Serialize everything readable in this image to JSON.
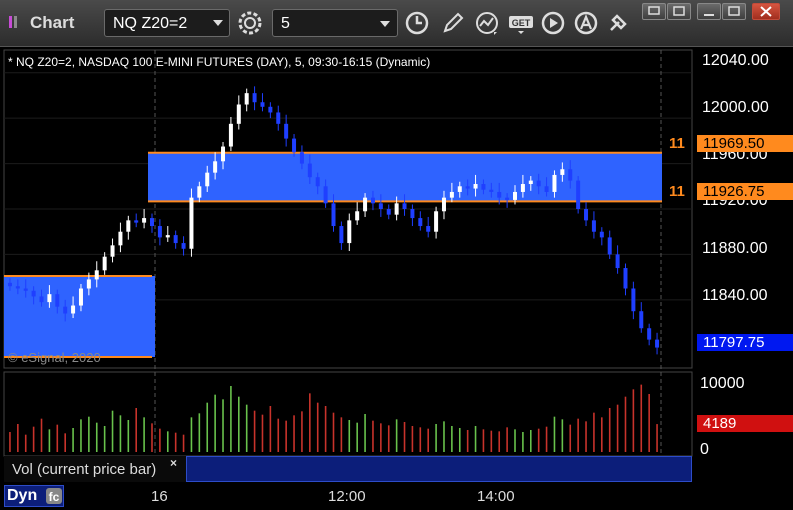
{
  "app": {
    "title": "Chart"
  },
  "toolbar": {
    "symbol": "NQ Z20=2",
    "interval": "5",
    "buttons": [
      "settings-gear-icon",
      "clock-icon",
      "pencil-icon",
      "line-study-icon",
      "get-data-icon",
      "play-icon",
      "alert-a-icon",
      "tools-icon"
    ]
  },
  "chart": {
    "info": "* NQ Z20=2, NASDAQ 100 E-MINI FUTURES (DAY), 5, 09:30-16:15 (Dynamic)",
    "copyright": "© eSignal, 2020",
    "price_labels": [
      "12040.00",
      "12000.00",
      "11960.00",
      "11920.00",
      "11880.00",
      "11840.00"
    ],
    "upper_line_label": "11969.50",
    "lower_line_label": "11926.75",
    "left_tag": "11",
    "last_price": "11797.75",
    "time_labels": [
      "16",
      "12:00",
      "14:00"
    ]
  },
  "volume": {
    "label": "Vol (current price bar)",
    "close_symbol": "×",
    "axis_labels": [
      "10000",
      "0"
    ],
    "current": "4189"
  },
  "footer": {
    "mode": "Dyn"
  },
  "colors": {
    "up": "#ffffff",
    "down": "#1f3fff",
    "zone": "#2f63ff",
    "line": "#ff8a1e",
    "vol_up": "#69c24c",
    "vol_down": "#c8332b"
  },
  "chart_data": {
    "type": "candlestick",
    "y_range": [
      11780,
      12060
    ],
    "volume_range": [
      0,
      12000
    ],
    "highlight_zones": [
      {
        "from": 11926.75,
        "to": 11969.5
      }
    ],
    "y_ticks": [
      12040,
      12000,
      11960,
      11920,
      11880,
      11840
    ],
    "closes": [
      11852,
      11850,
      11848,
      11843,
      11838,
      11845,
      11834,
      11828,
      11835,
      11850,
      11858,
      11866,
      11878,
      11888,
      11900,
      11910,
      11908,
      11912,
      11905,
      11895,
      11897,
      11890,
      11885,
      11930,
      11940,
      11952,
      11962,
      11975,
      11995,
      12012,
      12022,
      12014,
      12010,
      12005,
      11995,
      11982,
      11970,
      11960,
      11948,
      11940,
      11925,
      11905,
      11890,
      11910,
      11918,
      11930,
      11925,
      11920,
      11915,
      11925,
      11920,
      11912,
      11905,
      11900,
      11918,
      11930,
      11935,
      11940,
      11938,
      11942,
      11937,
      11935,
      11930,
      11928,
      11935,
      11942,
      11945,
      11940,
      11935,
      11950,
      11955,
      11945,
      11920,
      11910,
      11900,
      11895,
      11880,
      11868,
      11850,
      11830,
      11815,
      11805,
      11798
    ],
    "volumes": [
      3000,
      4200,
      2600,
      3800,
      5000,
      3400,
      4100,
      2800,
      3600,
      4900,
      5300,
      4400,
      3900,
      6200,
      5500,
      4800,
      6600,
      5200,
      4300,
      3500,
      3100,
      2900,
      2600,
      5200,
      5800,
      7400,
      8600,
      7900,
      9900,
      8300,
      7100,
      6200,
      5600,
      6900,
      5000,
      4700,
      5500,
      6100,
      8800,
      7400,
      6900,
      5900,
      5200,
      4800,
      4400,
      5700,
      4700,
      4300,
      4000,
      4900,
      4500,
      3900,
      3700,
      3500,
      4200,
      4600,
      3900,
      3600,
      3300,
      3900,
      3400,
      3200,
      3100,
      3700,
      3400,
      3000,
      3300,
      3500,
      3800,
      5300,
      4900,
      4100,
      5000,
      4600,
      5900,
      5200,
      6600,
      7100,
      8300,
      9400,
      10100,
      8700,
      4189
    ]
  }
}
